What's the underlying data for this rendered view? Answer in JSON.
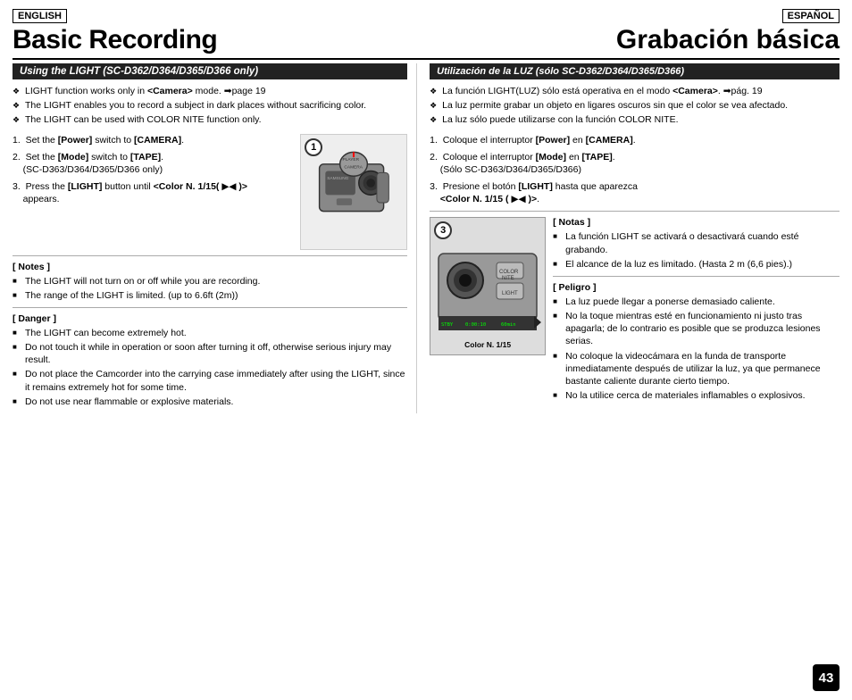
{
  "page": {
    "number": "43",
    "lang_en": "ENGLISH",
    "lang_es": "ESPAÑOL",
    "title_en": "Basic Recording",
    "title_es": "Grabación básica",
    "section_en": "Using the LIGHT (SC-D362/D364/D365/D366 only)",
    "section_es": "Utilización de la LUZ (sólo SC-D362/D364/D365/D366)",
    "bullets_en": [
      "LIGHT function works only in <Camera> mode. ➡page 19",
      "The LIGHT enables you to record a subject in dark places without sacrificing color.",
      "The LIGHT can be used with COLOR NITE function only."
    ],
    "bullets_es": [
      "La función LIGHT(LUZ) sólo está operativa en el modo <Camera>. ➡pág. 19",
      "La luz permite grabar un objeto en ligares oscuros sin que el color se vea afectado.",
      "La luz sólo puede utilizarse con la función COLOR NITE."
    ],
    "steps_en": [
      "Set the [Power] switch to [CAMERA].",
      "Set the [Mode] switch to [TAPE]. (SC-D363/D364/D365/D366 only)",
      "Press the [LIGHT] button until <Color N. 1/15( ▶◀ )> appears."
    ],
    "steps_es": [
      "Coloque el interruptor [Power] en [CAMERA].",
      "Coloque el interruptor [Mode] en [TAPE]. (Sólo SC-D363/D364/D365/D366)",
      "Presione el botón [LIGHT] hasta que aparezca <Color N. 1/15 ( ▶◀ )>."
    ],
    "notes_header_en": "[ Notes ]",
    "notes_en": [
      "The LIGHT will not turn on or off while you are recording.",
      "The range of the LIGHT is limited. (up to 6.6ft (2m))"
    ],
    "notes_header_es": "[ Notas ]",
    "notes_es": [
      "La función LIGHT se activará o desactivará cuando esté grabando.",
      "El alcance de la luz es limitado. (Hasta 2 m (6,6 pies).)"
    ],
    "danger_header_en": "[ Danger ]",
    "danger_en": [
      "The LIGHT can become extremely hot.",
      "Do not touch it while in operation or soon after turning it off, otherwise serious injury may result.",
      "Do not place the Camcorder into the carrying case immediately after using the LIGHT, since it remains extremely hot for some time.",
      "Do not use near flammable or explosive materials."
    ],
    "peligro_header_es": "[ Peligro ]",
    "peligro_es": [
      "La luz puede llegar a ponerse demasiado caliente.",
      "No la toque mientras esté en funcionamiento ni justo tras apagarla; de lo contrario es posible que se produzca lesiones serias.",
      "No coloque la videocámara en la funda de transporte inmediatamente después de utilizar la luz, ya que permanece bastante caliente durante cierto tiempo.",
      "No la utilice cerca de materiales inflamables o explosivos."
    ],
    "viewfinder": {
      "stby": "STBY",
      "time": "0:00:10",
      "tape": "60min",
      "color_nite": "Color N. 1/15"
    },
    "image_labels": {
      "color_nite": "COLOR NITE",
      "light": "LIGHT",
      "step1": "1",
      "step3": "3"
    }
  }
}
